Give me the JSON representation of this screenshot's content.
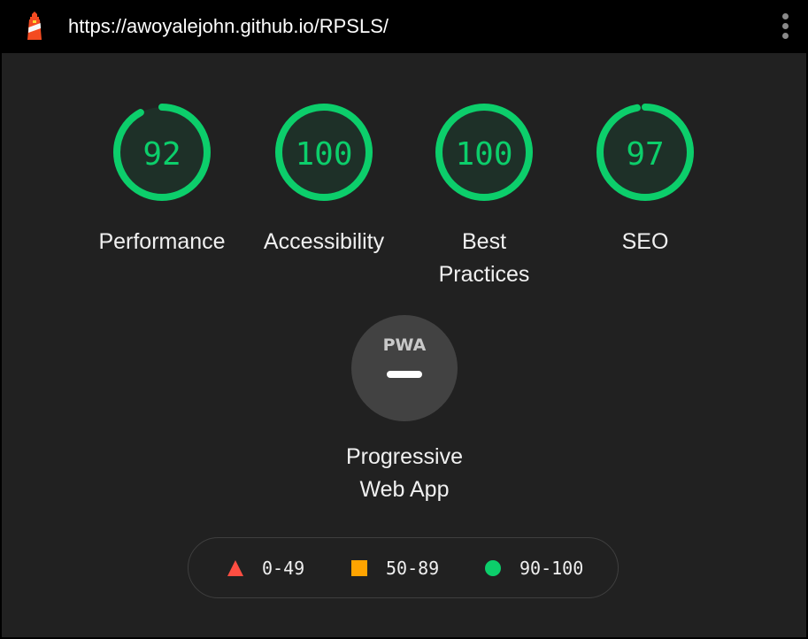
{
  "topbar": {
    "url": "https://awoyalejohn.github.io/RPSLS/",
    "logo_icon": "lighthouse-icon",
    "menu_icon": "more-vertical-icon"
  },
  "scores": [
    {
      "label": "Performance",
      "value": 92
    },
    {
      "label": "Accessibility",
      "value": 100
    },
    {
      "label": "Best Practices",
      "value": 100
    },
    {
      "label": "SEO",
      "value": 97
    }
  ],
  "pwa": {
    "badge_text": "PWA",
    "label": "Progressive Web App",
    "status": "not applicable"
  },
  "legend": [
    {
      "range": "0-49",
      "shape": "triangle",
      "color": "#ff4e42"
    },
    {
      "range": "50-89",
      "shape": "square",
      "color": "#ffa400"
    },
    {
      "range": "90-100",
      "shape": "circle",
      "color": "#0cce6b"
    }
  ],
  "colors": {
    "pass": "#0cce6b",
    "pass_fill": "#1e3028",
    "panel_bg": "#212121",
    "topbar_bg": "#000000"
  }
}
